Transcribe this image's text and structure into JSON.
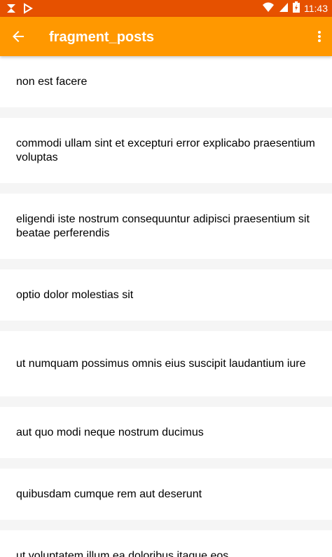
{
  "status_bar": {
    "time": "11:43",
    "left_icons": [
      "notification-app-icon",
      "play-store-icon"
    ],
    "right_icons": [
      "wifi-icon",
      "signal-icon",
      "battery-icon"
    ]
  },
  "app_bar": {
    "title": "fragment_posts",
    "back_icon": "arrow-back-icon",
    "menu_icon": "more-vert-icon",
    "color": "#ff9800",
    "status_color": "#e65100"
  },
  "posts": [
    {
      "title": "non est facere"
    },
    {
      "title": "commodi ullam sint et excepturi error explicabo praesentium voluptas"
    },
    {
      "title": "eligendi iste nostrum consequuntur adipisci praesentium sit beatae perferendis"
    },
    {
      "title": "optio dolor molestias sit"
    },
    {
      "title": "ut numquam possimus omnis eius suscipit laudantium iure"
    },
    {
      "title": "aut quo modi neque nostrum ducimus"
    },
    {
      "title": "quibusdam cumque rem aut deserunt"
    },
    {
      "title": "ut voluptatem illum ea doloribus itaque eos"
    }
  ]
}
